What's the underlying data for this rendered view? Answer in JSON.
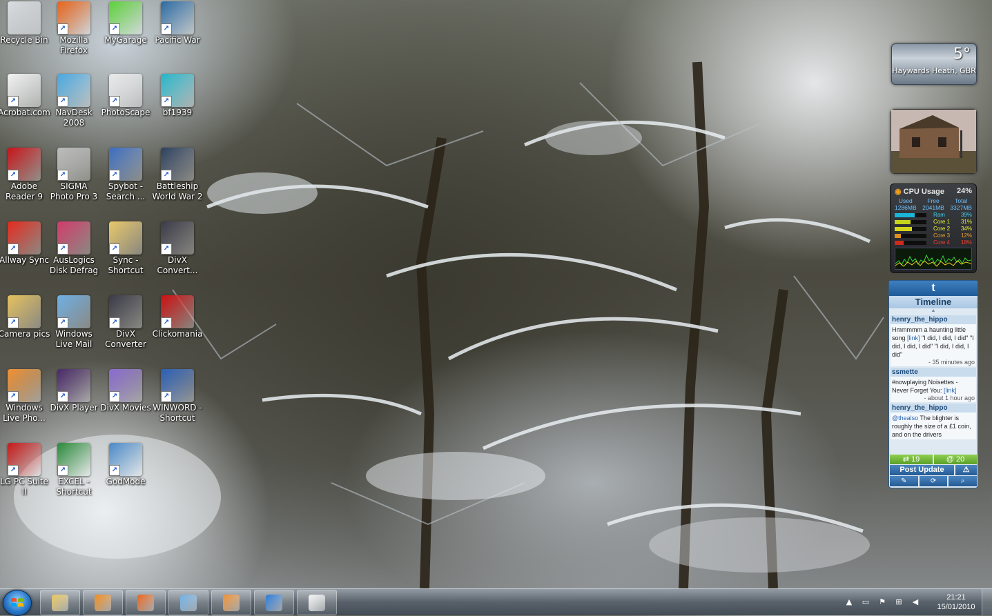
{
  "desktop": {
    "icons": [
      {
        "label": "Recycle Bin",
        "icon": "recycle-bin-icon",
        "color": "#d9dde2"
      },
      {
        "label": "Mozilla Firefox",
        "icon": "firefox-icon",
        "color": "#e8641b"
      },
      {
        "label": "MyGarage",
        "icon": "car-icon",
        "color": "#5dd23a"
      },
      {
        "label": "Pacific War",
        "icon": "battleship-icon",
        "color": "#2b6aa3"
      },
      {
        "label": "Acrobat.com",
        "icon": "acrobat-icon",
        "color": "#f2f2f2"
      },
      {
        "label": "NavDesk 2008",
        "icon": "navdesk-icon",
        "color": "#48a8e0"
      },
      {
        "label": "PhotoScape",
        "icon": "photoscape-icon",
        "color": "#e8e8e8"
      },
      {
        "label": "bf1939",
        "icon": "soldier-portrait-icon",
        "color": "#23b4c8"
      },
      {
        "label": "Adobe Reader 9",
        "icon": "adobe-reader-icon",
        "color": "#c8141a"
      },
      {
        "label": "SIGMA Photo Pro 3",
        "icon": "camera-icon",
        "color": "#bbbbbb"
      },
      {
        "label": "Spybot - Search ...",
        "icon": "spybot-icon",
        "color": "#3a6cc0"
      },
      {
        "label": "Battleship World War 2",
        "icon": "admiral-portrait-icon",
        "color": "#2c3f5e"
      },
      {
        "label": "Allway Sync",
        "icon": "allway-sync-icon",
        "color": "#e52a1e"
      },
      {
        "label": "AusLogics Disk Defrag",
        "icon": "disk-defrag-icon",
        "color": "#d23b6a"
      },
      {
        "label": "Sync - Shortcut",
        "icon": "folder-icon",
        "color": "#e9c86a"
      },
      {
        "label": "DivX Convert...",
        "icon": "divx-converter-icon",
        "color": "#3a3a48"
      },
      {
        "label": "Camera pics",
        "icon": "folder-icon",
        "color": "#e6c25e"
      },
      {
        "label": "Windows Live Mail",
        "icon": "mail-icon",
        "color": "#6fb0e6"
      },
      {
        "label": "DivX Converter",
        "icon": "divx-converter-icon",
        "color": "#3a3a48"
      },
      {
        "label": "Clickomania",
        "icon": "clickomania-icon",
        "color": "#cc1010"
      },
      {
        "label": "Windows Live Pho...",
        "icon": "photo-gallery-icon",
        "color": "#f09030"
      },
      {
        "label": "DivX Player",
        "icon": "play-icon",
        "color": "#4a2a6a"
      },
      {
        "label": "DivX Movies",
        "icon": "divx-movies-icon",
        "color": "#8a6ad0"
      },
      {
        "label": "WINWORD - Shortcut",
        "icon": "word-icon",
        "color": "#2b5fb8"
      },
      {
        "label": "LG PC Suite II",
        "icon": "lg-phone-icon",
        "color": "#c81a1a"
      },
      {
        "label": "EXCEL - Shortcut",
        "icon": "excel-icon",
        "color": "#2a8a3a"
      },
      {
        "label": "GodMode",
        "icon": "control-panel-icon",
        "color": "#4a8ac8"
      }
    ]
  },
  "gadgets": {
    "weather": {
      "temperature": "5°",
      "location": "Haywards Heath, GBR"
    },
    "cpu": {
      "title": "CPU Usage",
      "total_percent": "24%",
      "used_label": "Used",
      "used_value": "1286MB",
      "free_label": "Free",
      "free_value": "2041MB",
      "total_label": "Total",
      "total_value": "3327MB",
      "rows": [
        {
          "name": "Ram",
          "value": "39%",
          "pct": 39,
          "color": "#19b6d8",
          "text_color": "#3fd0f0"
        },
        {
          "name": "Core 1",
          "value": "31%",
          "pct": 31,
          "color": "#c6d51b",
          "text_color": "#e8f03a"
        },
        {
          "name": "Core 2",
          "value": "34%",
          "pct": 34,
          "color": "#d5d51b",
          "text_color": "#f0f03a"
        },
        {
          "name": "Core 3",
          "value": "12%",
          "pct": 12,
          "color": "#e09018",
          "text_color": "#f0a030"
        },
        {
          "name": "Core 4",
          "value": "18%",
          "pct": 18,
          "color": "#d02a1a",
          "text_color": "#f04030"
        }
      ]
    },
    "twitter": {
      "logo": "t",
      "title": "Timeline",
      "tweets": [
        {
          "user": "henry_the_hippo",
          "text": "Hmmmmm a haunting little song ",
          "link": "[link]",
          "text2": " \"I did, I did, I did\" \"I did, I did, I did\" \"I did, I did, I did\"",
          "ago": "- 35 minutes ago"
        },
        {
          "user": "ssmette",
          "text": "#nowplaying Noisettes - Never Forget You: ",
          "link": "[link]",
          "text2": "",
          "ago": "- about 1 hour ago"
        },
        {
          "user": "henry_the_hippo",
          "text": "",
          "link": "@thealso",
          "text2": " The blighter is roughly the size of a £1 coin, and on the drivers",
          "ago": ""
        }
      ],
      "count_retweets": "19",
      "count_mentions": "@ 20",
      "post_label": "Post Update"
    }
  },
  "taskbar": {
    "buttons": [
      {
        "name": "explorer",
        "icon": "folder-icon",
        "color": "#e8c660"
      },
      {
        "name": "media-player",
        "icon": "media-player-icon",
        "color": "#f08a1a"
      },
      {
        "name": "firefox",
        "icon": "firefox-icon",
        "color": "#e8641b"
      },
      {
        "name": "windows-live-mail",
        "icon": "mail-icon",
        "color": "#6fb0e6"
      },
      {
        "name": "photo-gallery",
        "icon": "photo-gallery-icon",
        "color": "#f09030"
      },
      {
        "name": "internet-explorer",
        "icon": "internet-explorer-icon",
        "color": "#2a7ad8"
      },
      {
        "name": "solitaire",
        "icon": "cards-icon",
        "color": "#f2f2f2"
      }
    ],
    "clock_time": "21:21",
    "clock_date": "15/01/2010"
  }
}
